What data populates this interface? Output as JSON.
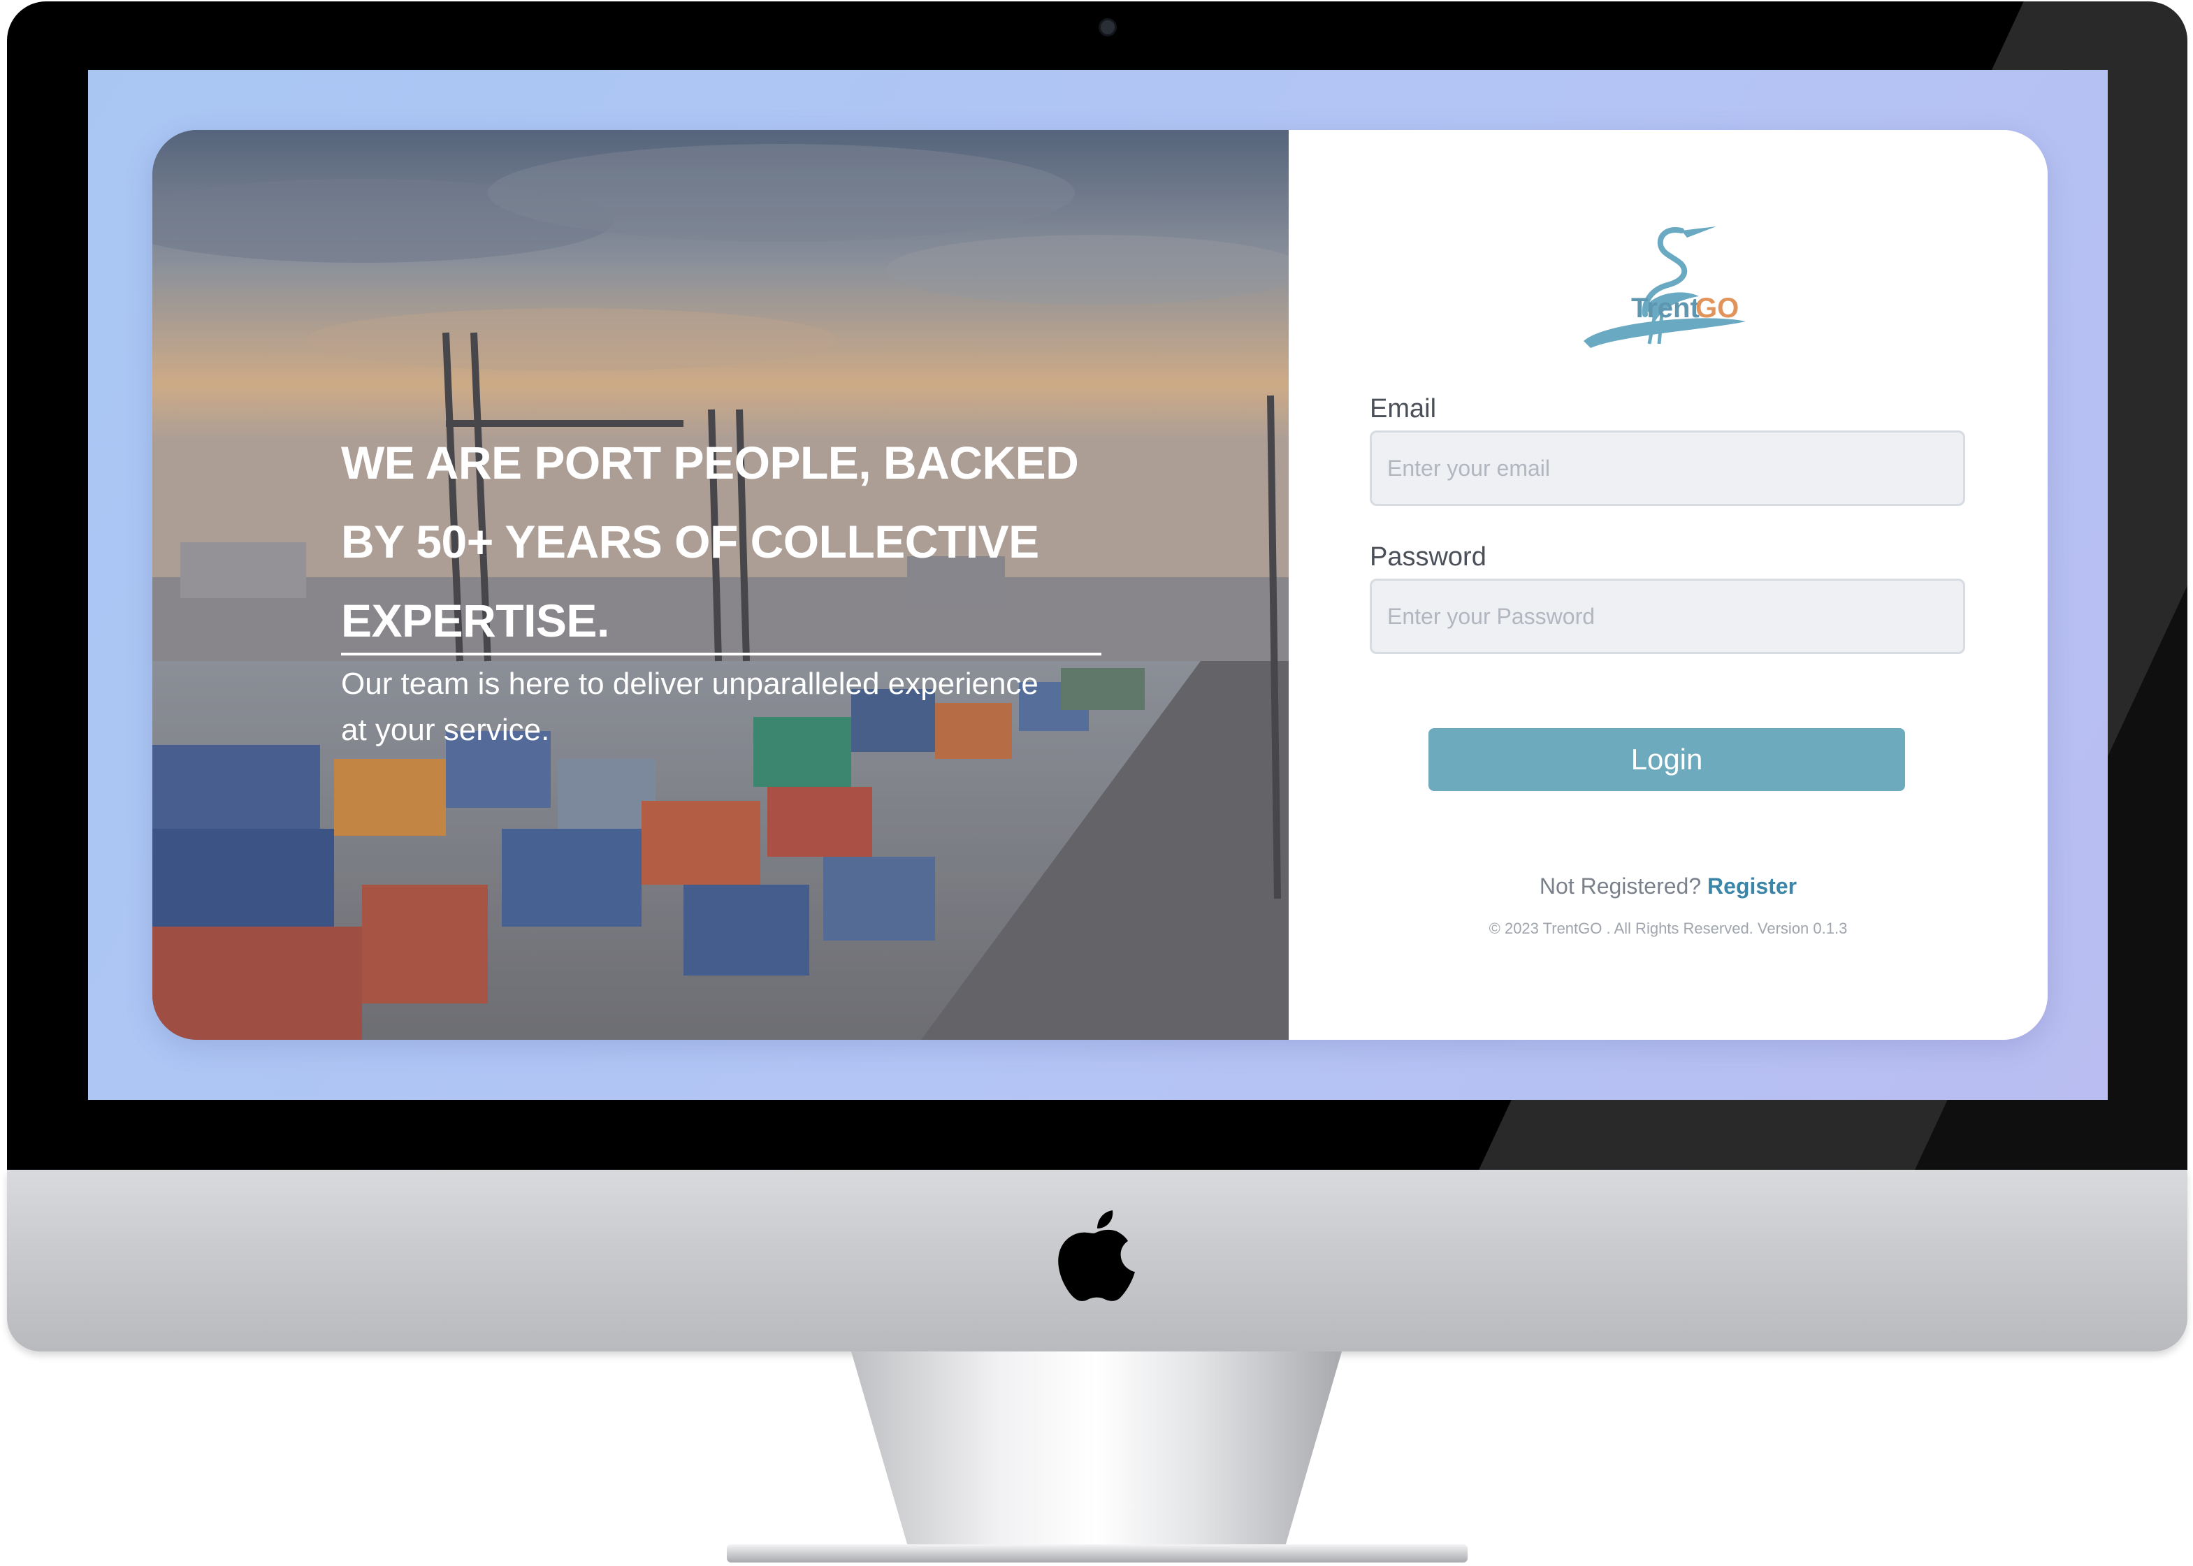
{
  "hero": {
    "headline": "WE ARE PORT PEOPLE, BACKED BY 50+ YEARS OF COLLECTIVE EXPERTISE.",
    "subtext": "Our team is here to deliver unparalleled experience at your service."
  },
  "brand": {
    "name": "TrentGO",
    "name_part_1": "Trent",
    "name_part_2": "GO",
    "logo_icon": "heron-icon",
    "color_primary": "#6aa9c2",
    "color_accent": "#e0935a"
  },
  "login": {
    "email_label": "Email",
    "email_placeholder": "Enter your email",
    "password_label": "Password",
    "password_placeholder": "Enter your Password",
    "submit_label": "Login",
    "not_registered": "Not Registered?",
    "register_label": "Register",
    "footer": "© 2023 TrentGO . All Rights Reserved. Version 0.1.3",
    "button_color": "#6eaabd"
  },
  "device": {
    "logo_icon": "apple-logo-icon"
  }
}
